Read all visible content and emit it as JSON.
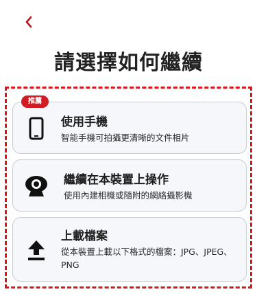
{
  "header": {
    "back_icon": "chevron-left-icon",
    "title": "請選擇如何繼續"
  },
  "options": [
    {
      "icon": "smartphone-icon",
      "badge": "推薦",
      "title": "使用手機",
      "description": "智能手機可拍攝更清晰的文件相片"
    },
    {
      "icon": "webcam-icon",
      "title": "繼續在本裝置上操作",
      "description": "使用內建相機或隨附的網絡攝影機"
    },
    {
      "icon": "upload-icon",
      "title": "上載檔案",
      "description": "從本裝置上載以下格式的檔案：JPG、JPEG、PNG"
    }
  ],
  "colors": {
    "accent": "#d01c22",
    "frame": "#d9161c",
    "card_bg": "#f6f7fb"
  }
}
